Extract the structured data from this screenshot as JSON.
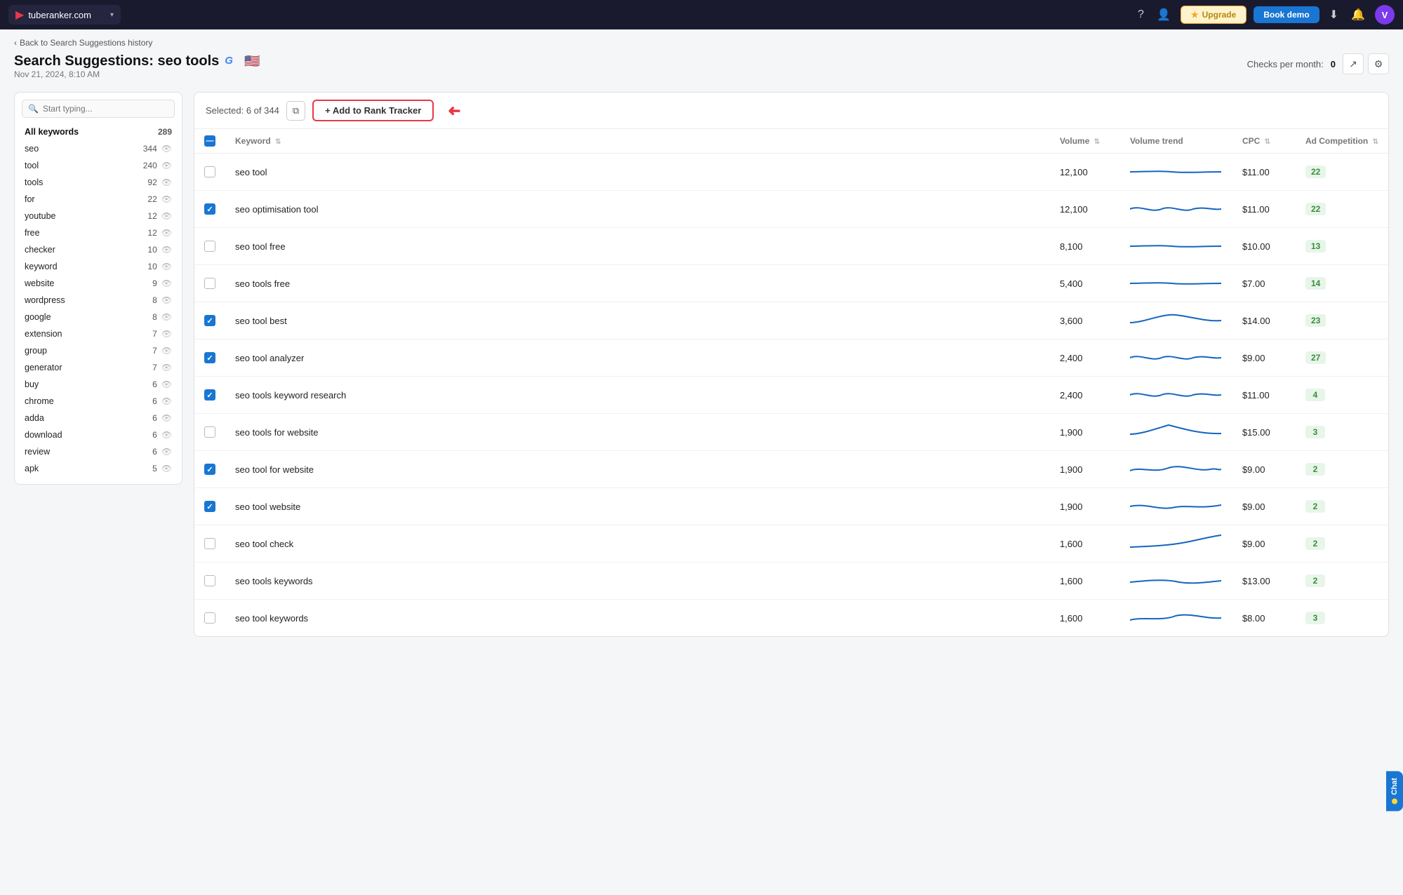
{
  "topnav": {
    "brand": "tuberanker.com",
    "upgrade_label": "Upgrade",
    "bookdemo_label": "Book demo",
    "avatar_letter": "V"
  },
  "breadcrumb": "Back to Search Suggestions history",
  "page": {
    "title": "Search Suggestions: seo tools",
    "date": "Nov 21, 2024, 8:10 AM",
    "checks_label": "Checks per month:",
    "checks_value": "0"
  },
  "toolbar": {
    "selected_label": "Selected: 6 of 344",
    "add_tracker_label": "+ Add to Rank Tracker"
  },
  "sidebar": {
    "search_placeholder": "Start typing...",
    "all_keywords_label": "All keywords",
    "all_keywords_count": "289",
    "items": [
      {
        "label": "seo",
        "count": "344"
      },
      {
        "label": "tool",
        "count": "240"
      },
      {
        "label": "tools",
        "count": "92"
      },
      {
        "label": "for",
        "count": "22"
      },
      {
        "label": "youtube",
        "count": "12"
      },
      {
        "label": "free",
        "count": "12"
      },
      {
        "label": "checker",
        "count": "10"
      },
      {
        "label": "keyword",
        "count": "10"
      },
      {
        "label": "website",
        "count": "9"
      },
      {
        "label": "wordpress",
        "count": "8"
      },
      {
        "label": "google",
        "count": "8"
      },
      {
        "label": "extension",
        "count": "7"
      },
      {
        "label": "group",
        "count": "7"
      },
      {
        "label": "generator",
        "count": "7"
      },
      {
        "label": "buy",
        "count": "6"
      },
      {
        "label": "chrome",
        "count": "6"
      },
      {
        "label": "adda",
        "count": "6"
      },
      {
        "label": "download",
        "count": "6"
      },
      {
        "label": "review",
        "count": "6"
      },
      {
        "label": "apk",
        "count": "5"
      }
    ]
  },
  "table": {
    "columns": [
      "Keyword",
      "Volume",
      "Volume trend",
      "CPC",
      "Ad Competition"
    ],
    "rows": [
      {
        "keyword": "seo tool",
        "volume": "12,100",
        "cpc": "$11.00",
        "adcomp": 22,
        "checked": false,
        "sparkline": "flat"
      },
      {
        "keyword": "seo optimisation tool",
        "volume": "12,100",
        "cpc": "$11.00",
        "adcomp": 22,
        "checked": true,
        "sparkline": "wavy"
      },
      {
        "keyword": "seo tool free",
        "volume": "8,100",
        "cpc": "$10.00",
        "adcomp": 13,
        "checked": false,
        "sparkline": "flat"
      },
      {
        "keyword": "seo tools free",
        "volume": "5,400",
        "cpc": "$7.00",
        "adcomp": 14,
        "checked": false,
        "sparkline": "flat"
      },
      {
        "keyword": "seo tool best",
        "volume": "3,600",
        "cpc": "$14.00",
        "adcomp": 23,
        "checked": true,
        "sparkline": "bump"
      },
      {
        "keyword": "seo tool analyzer",
        "volume": "2,400",
        "cpc": "$9.00",
        "adcomp": 27,
        "checked": true,
        "sparkline": "wavy"
      },
      {
        "keyword": "seo tools keyword research",
        "volume": "2,400",
        "cpc": "$11.00",
        "adcomp": 4,
        "checked": true,
        "sparkline": "wavy"
      },
      {
        "keyword": "seo tools for website",
        "volume": "1,900",
        "cpc": "$15.00",
        "adcomp": 3,
        "checked": false,
        "sparkline": "bump2"
      },
      {
        "keyword": "seo tool for website",
        "volume": "1,900",
        "cpc": "$9.00",
        "adcomp": 2,
        "checked": true,
        "sparkline": "wavy2"
      },
      {
        "keyword": "seo tool website",
        "volume": "1,900",
        "cpc": "$9.00",
        "adcomp": 2,
        "checked": true,
        "sparkline": "wavy3"
      },
      {
        "keyword": "seo tool check",
        "volume": "1,600",
        "cpc": "$9.00",
        "adcomp": 2,
        "checked": false,
        "sparkline": "rise"
      },
      {
        "keyword": "seo tools keywords",
        "volume": "1,600",
        "cpc": "$13.00",
        "adcomp": 2,
        "checked": false,
        "sparkline": "flat2"
      },
      {
        "keyword": "seo tool keywords",
        "volume": "1,600",
        "cpc": "$8.00",
        "adcomp": 3,
        "checked": false,
        "sparkline": "wavy4"
      }
    ]
  },
  "chat": {
    "label": "Chat"
  }
}
